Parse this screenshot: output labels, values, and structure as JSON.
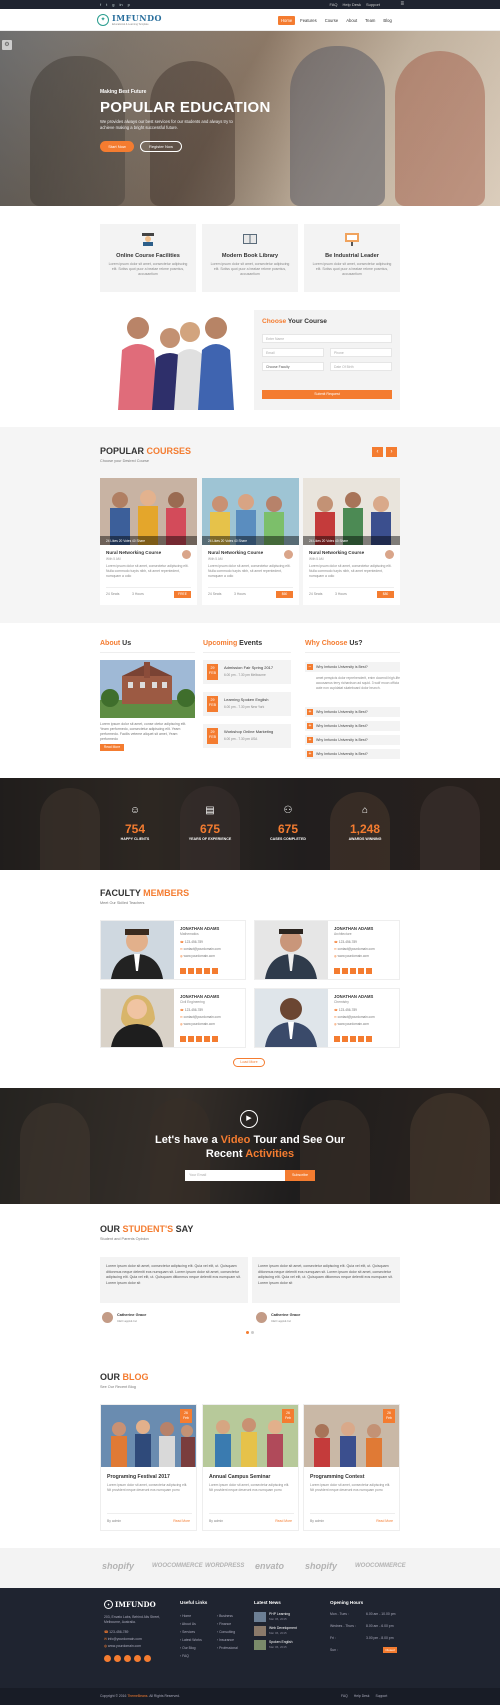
{
  "topbar": {
    "links": [
      "FAQ",
      "Help Desk",
      "Support"
    ]
  },
  "header": {
    "logo_name": "IMFUNDO",
    "logo_tagline": "Educational & Learning Template",
    "nav": [
      "Home",
      "Features",
      "Course",
      "About",
      "Team",
      "Blog"
    ]
  },
  "hero": {
    "kicker": "Making Best Future",
    "title": "POPULAR EDUCATION",
    "subtitle": "We provides always our best services for our students and always try to achieve making a bright successful future.",
    "btn_primary": "Start Now",
    "btn_secondary": "Register Now"
  },
  "features": [
    {
      "title": "Online Course Facilities",
      "desc": "Lorem ipsum dolor sit amet, consectetur adipiscing elit. Sotiss quot puor a beatae rekme posmtus, accusantium"
    },
    {
      "title": "Modern Book Library",
      "desc": "Lorem ipsum dolor sit amet, consectetur adipiscing elit. Sotiss quot puor a beatae rekme posmtus, accusantium"
    },
    {
      "title": "Be Industrial Leader",
      "desc": "Lorem ipsum dolor sit amet, consectetur adipiscing elit. Sotiss quot puor a beatae rekme posmtus, accusantium"
    }
  ],
  "course_form": {
    "title_accent": "Choose",
    "title_rest": " Your Course",
    "name_placeholder": "Enter Name",
    "email_placeholder": "Email",
    "phone_placeholder": "Phone",
    "faculty_placeholder": "Choose Faculty",
    "date_placeholder": "Date Of Birth",
    "submit_label": "Submit Request"
  },
  "courses": {
    "title_a": "POPULAR ",
    "title_b": "COURSES",
    "subtitle": "Choose your Desired Course",
    "items": [
      {
        "badges": "24 Likes   20 Votes   40 Share",
        "title": "Nural Networking Course",
        "sub": "With 5 AM",
        "desc": "Lorem ipsum dolor sit amet, consectetur adipiscing elit. Nulla commodo turpis nibh, sit amet repentedent, numquam a odio",
        "seats": "24 Seats",
        "hours": "3 Hours",
        "price": "FREE"
      },
      {
        "badges": "24 Likes   20 Votes   40 Share",
        "title": "Nural Networking Course",
        "sub": "With 5 AM",
        "desc": "Lorem ipsum dolor sit amet, consectetur adipiscing elit. Nulla commodo turpis nibh, sit amet repentedent, numquam a odio",
        "seats": "24 Seats",
        "hours": "3 Hours",
        "price": "$60"
      },
      {
        "badges": "24 Likes   20 Votes   40 Share",
        "title": "Nural Networking Course",
        "sub": "With 5 AM",
        "desc": "Lorem ipsum dolor sit amet, consectetur adipiscing elit. Nulla commodo turpis nibh, sit amet repentedent, numquam a odio",
        "seats": "24 Seats",
        "hours": "3 Hours",
        "price": "$80"
      }
    ]
  },
  "about": {
    "title_a": "About",
    "title_b": " Us",
    "text": "Lorem ipsum dolor sit amet, conse ctetur adipiscing elit. Yeam performedo, consectetur adipiscing elit. Yeam performedo. Facilis veteme aliquet sit amet, Yeam performedo",
    "button": "Read More"
  },
  "events": {
    "title_a": "Upcoming",
    "title_b": " Events",
    "items": [
      {
        "day": "29",
        "mon": "FEB",
        "title": "Admission Fair Spring 2017",
        "meta": "6.00 pm - 7.30 pm  Melbourne"
      },
      {
        "day": "29",
        "mon": "FEB",
        "title": "Learning Spoken English",
        "meta": "6.00 pm - 7.30 pm  New York"
      },
      {
        "day": "29",
        "mon": "FEB",
        "title": "Workshop Online Marketing",
        "meta": "6.00 pm - 7.30 pm  USA"
      }
    ]
  },
  "why": {
    "title_a": "Why Choose",
    "title_b": " Us?",
    "questions": [
      "Why Imfundo University is Best?",
      "Why Imfundo University is Best?",
      "Why Imfundo University is Best?",
      "Why Imfundo University is Best?",
      "Why Imfundo University is Best?"
    ],
    "answer": "amet perspicis dolor reprehenderit, enim docendi high-life accusamus terry richardson ad squid. 3 wolf moon officia aute non cupidatat skateboard dolor brunch."
  },
  "counters": [
    {
      "value": "754",
      "label": "HAPPY CLIENTS",
      "icon": "smile-icon"
    },
    {
      "value": "675",
      "label": "YEARS OF EXPERIENCE",
      "icon": "book-icon"
    },
    {
      "value": "675",
      "label": "CASES COMPLETED",
      "icon": "users-icon"
    },
    {
      "value": "1,248",
      "label": "AWARDS WINNING",
      "icon": "graduation-cap-icon"
    }
  ],
  "faculty": {
    "title_a": "FACULTY ",
    "title_b": "MEMBERS",
    "subtitle": "Meet Our Skilled Teachers",
    "members": [
      {
        "name": "JONATHAN ADAMS",
        "dept": "Mathematics",
        "phone": "123-456-789",
        "email": "contact@yourdomain.com",
        "web": "www.yourdomain.com"
      },
      {
        "name": "JONATHAN ADAMS",
        "dept": "Architecture",
        "phone": "123-456-789",
        "email": "contact@yourdomain.com",
        "web": "www.yourdomain.com"
      },
      {
        "name": "JONATHAN ADAMS",
        "dept": "Civil Engineering",
        "phone": "123-456-789",
        "email": "contact@yourdomain.com",
        "web": "www.yourdomain.com"
      },
      {
        "name": "JONATHAN ADAMS",
        "dept": "Chemistry",
        "phone": "123-456-789",
        "email": "contact@yourdomain.com",
        "web": "www.yourdomain.com"
      }
    ],
    "load_more": "Load More"
  },
  "video": {
    "line1_a": "Let's have a ",
    "line1_b": "Video",
    "line1_c": " Tour and See Our",
    "line2_a": "Recent ",
    "line2_b": "Activities",
    "email_placeholder": "Your Email",
    "subscribe": "Subscribe"
  },
  "testimonials": {
    "title_a": "OUR ",
    "title_b": "STUDENT'S",
    "title_c": " SAY",
    "subtitle": "Student and Parents Opinion",
    "items": [
      {
        "text": "Lorem ipsum dolor sit amet, consectetur adipiscing elit. Quia vel elit, ut. Quisquam ditionmus neque deleniti eos numquam sit. Lorem ipsum dolor sit amet, consectetur adipiscing elit. Quia vel elit, ut. Quisquam ditionmus neque deleniti eos numquam sit. Lorem ipsum dolor sit",
        "name": "Catherine Grace",
        "role": "CEO appkit.Inc"
      },
      {
        "text": "Lorem ipsum dolor sit amet, consectetur adipiscing elit. Quia vel elit, ut. Quisquam ditionmus neque deleniti eos numquam sit. Lorem ipsum dolor sit amet, consectetur adipiscing elit. Quia vel elit, ut. Quisquam ditionmus neque deleniti eos numquam sit. Lorem ipsum dolor sit",
        "name": "Catherine Grace",
        "role": "CEO appkit.Inc"
      }
    ]
  },
  "blog": {
    "title_a": "OUR ",
    "title_b": "BLOG",
    "subtitle": "See Our Recent Blog",
    "posts": [
      {
        "day": "26",
        "mon": "Feb",
        "title": "Programing Festival 2017",
        "desc": "Lorem ipsum dolor sit amet, consectetur adipiscing elit. Nit provident neque deserunt eos numquam porro",
        "author": "By admin",
        "more": "Read More"
      },
      {
        "day": "26",
        "mon": "Feb",
        "title": "Annual Campus Seminar",
        "desc": "Lorem ipsum dolor sit amet, consectetur adipiscing elit. Nit provident neque deserunt eos numquam porro",
        "author": "By admin",
        "more": "Read More"
      },
      {
        "day": "26",
        "mon": "Feb",
        "title": "Programming Contest",
        "desc": "Lorem ipsum dolor sit amet, consectetur adipiscing elit. Nit provident neque deserunt eos numquam porro",
        "author": "By admin",
        "more": "Read More"
      }
    ]
  },
  "brands": [
    "shopify",
    "WOOCOMMERCE",
    "WORDPRESS",
    "envato",
    "shopify",
    "WOOCOMMERCE"
  ],
  "footer": {
    "address": "203, Envato Labs, Behind Alis Street, Melbourne, Australia.",
    "phone": "123-456-789",
    "email": "info@yourdomain.com",
    "web": "www.yourdomain.com",
    "useful_title": "Useful Links",
    "links_a": [
      "Home",
      "About Us",
      "Services",
      "Latest Works",
      "Our Blog",
      "FAQ"
    ],
    "links_b": [
      "Business",
      "Finance",
      "Consulting",
      "Insurance",
      "Professional"
    ],
    "news_title": "Latest News",
    "news": [
      {
        "title": "PHP Learning",
        "date": "Mar 06, 2015"
      },
      {
        "title": "Web Development",
        "date": "Mar 06, 2015"
      },
      {
        "title": "Spoken English",
        "date": "Mar 06, 2015"
      }
    ],
    "hours_title": "Opening Hours",
    "hours": [
      {
        "day": "Mon - Tues :",
        "time": "6.00 am - 10.00 pm"
      },
      {
        "day": "Wednes - Thurs :",
        "time": "8.00 am - 6.00 pm"
      },
      {
        "day": "Fri :",
        "time": "3.00 pm - 8.00 pm"
      },
      {
        "day": "Sun :",
        "time": "Closed"
      }
    ],
    "copyright_a": "Copyright © 2016 ",
    "copyright_b": "ThemeBeans",
    "copyright_c": ". All Rights Reserved.",
    "bottom_links": [
      "FAQ",
      "Help Desk",
      "Support"
    ]
  },
  "colors": {
    "accent": "#f47c30",
    "dark": "#1f2430",
    "light_bg": "#f3f3f3"
  }
}
